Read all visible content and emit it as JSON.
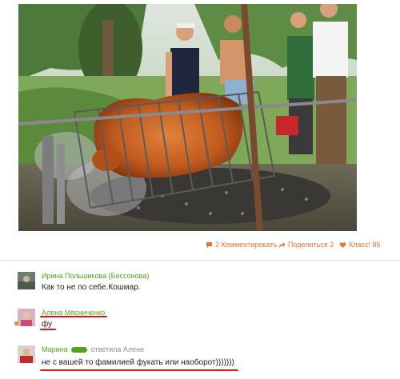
{
  "actions": {
    "comments_label": "2 Комментировать",
    "share_label": "Поделиться 2",
    "like_label": "Класс! 85"
  },
  "comments": [
    {
      "author": "Ирина Польшикова (Бессонова)",
      "text": "Как то не по себе.Кошмар."
    },
    {
      "author": "Алена Мясниченко",
      "text": "фу"
    },
    {
      "author": "Марина",
      "reply_to": "ответила Алене",
      "text": "не с вашей то фамилией фукать или наоборот)))))))"
    }
  ],
  "colors": {
    "accent": "#eb722e",
    "author": "#53a31c",
    "annotation": "#d91a1a"
  }
}
